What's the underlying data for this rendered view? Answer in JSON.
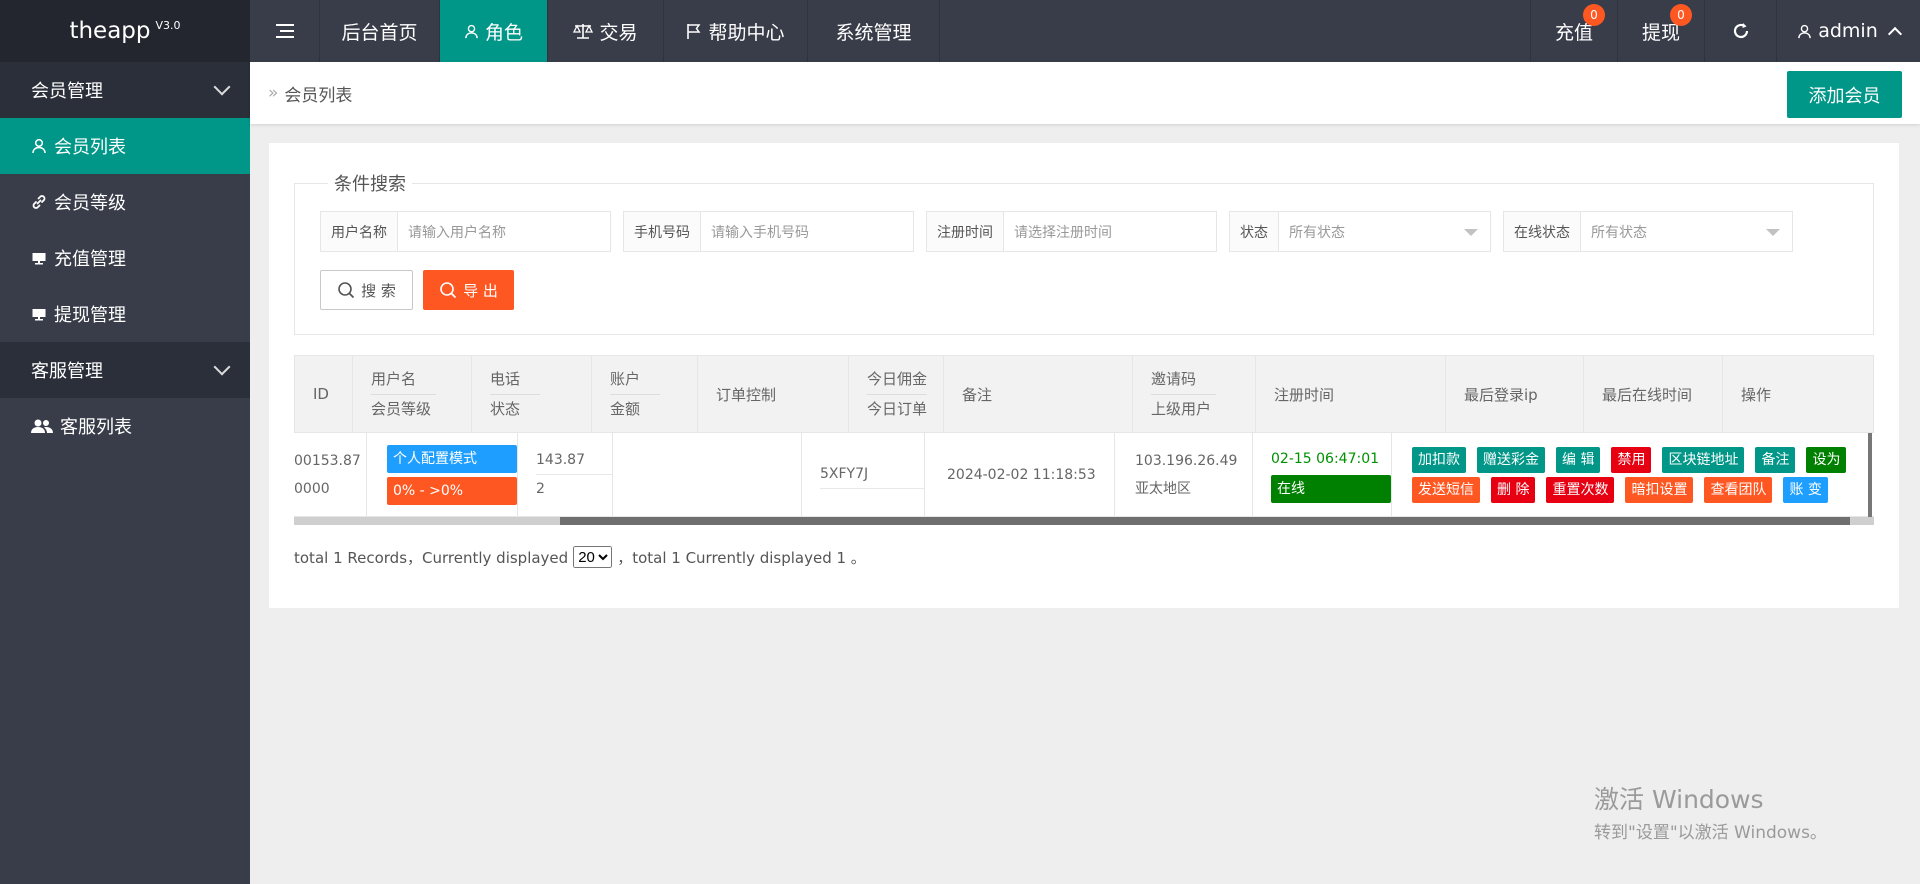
{
  "app": {
    "name": "theapp",
    "version": "V3.0"
  },
  "topnav": {
    "menu_icon": "hamburger-icon",
    "items": [
      {
        "label": "后台首页"
      },
      {
        "label": "角色",
        "icon": "user-icon",
        "active": true
      },
      {
        "label": "交易",
        "icon": "scale-icon"
      },
      {
        "label": "帮助中心",
        "icon": "flag-icon"
      },
      {
        "label": "系统管理"
      }
    ],
    "right": {
      "recharge_label": "充值",
      "recharge_badge": "0",
      "withdraw_label": "提现",
      "withdraw_badge": "0",
      "refresh_icon": "refresh-icon",
      "user_label": "admin"
    }
  },
  "sidebar": {
    "groups": [
      {
        "label": "会员管理",
        "items": [
          {
            "label": "会员列表",
            "icon": "user-icon",
            "active": true
          },
          {
            "label": "会员等级",
            "icon": "link-icon"
          },
          {
            "label": "充值管理",
            "icon": "monitor-icon"
          },
          {
            "label": "提现管理",
            "icon": "monitor-icon"
          }
        ]
      },
      {
        "label": "客服管理",
        "items": [
          {
            "label": "客服列表",
            "icon": "users-icon"
          }
        ]
      }
    ]
  },
  "breadcrumb": {
    "current": "会员列表"
  },
  "add_button_label": "添加会员",
  "search": {
    "legend": "条件搜索",
    "username": {
      "label": "用户名称",
      "placeholder": "请输入用户名称"
    },
    "phone": {
      "label": "手机号码",
      "placeholder": "请输入手机号码"
    },
    "regtime": {
      "label": "注册时间",
      "placeholder": "请选择注册时间"
    },
    "status": {
      "label": "状态",
      "value": "所有状态"
    },
    "online": {
      "label": "在线状态",
      "value": "所有状态"
    },
    "search_button": "搜 索",
    "export_button": "导 出"
  },
  "table": {
    "headers": {
      "id": "ID",
      "username": "用户名",
      "level": "会员等级",
      "phone": "电话",
      "status": "状态",
      "account": "账户",
      "balance": "金额",
      "order_control": "订单控制",
      "today_commission": "今日佣金",
      "today_orders": "今日订单",
      "remark": "备注",
      "invite_code": "邀请码",
      "parent_user": "上级用户",
      "reg_time": "注册时间",
      "last_ip": "最后登录ip",
      "last_online": "最后在线时间",
      "actions": "操作"
    },
    "row": {
      "c1a": "00153.87",
      "c1b": "0000",
      "config_mode": "个人配置模式",
      "range": "0% - >0%",
      "val1": "143.87",
      "val2": "2",
      "invite_code": "5XFY7J",
      "reg_time": "2024-02-02 11:18:53",
      "ip": "103.196.26.49",
      "region": "亚太地区",
      "last_online": "02-15 06:47:01",
      "online_status": "在线",
      "actions_row1": [
        "加扣款",
        "赠送彩金",
        "编 辑",
        "禁用",
        "区块链地址",
        "备注",
        "设为"
      ],
      "actions_row2": [
        "发送短信",
        "删 除",
        "重置次数",
        "暗扣设置",
        "查看团队",
        "账 变"
      ]
    }
  },
  "pager": {
    "prefix": "total 1 Records，Currently displayed",
    "page_size": "20",
    "suffix": "，total 1 Currently displayed 1 。"
  },
  "watermark": {
    "line1": "激活 Windows",
    "line2": "转到\"设置\"以激活 Windows。"
  },
  "colors": {
    "accent": "#009688",
    "sidebar": "#393d49",
    "danger": "#e60012",
    "warn": "#ff5722",
    "info": "#1e9fff",
    "success": "#008000"
  }
}
